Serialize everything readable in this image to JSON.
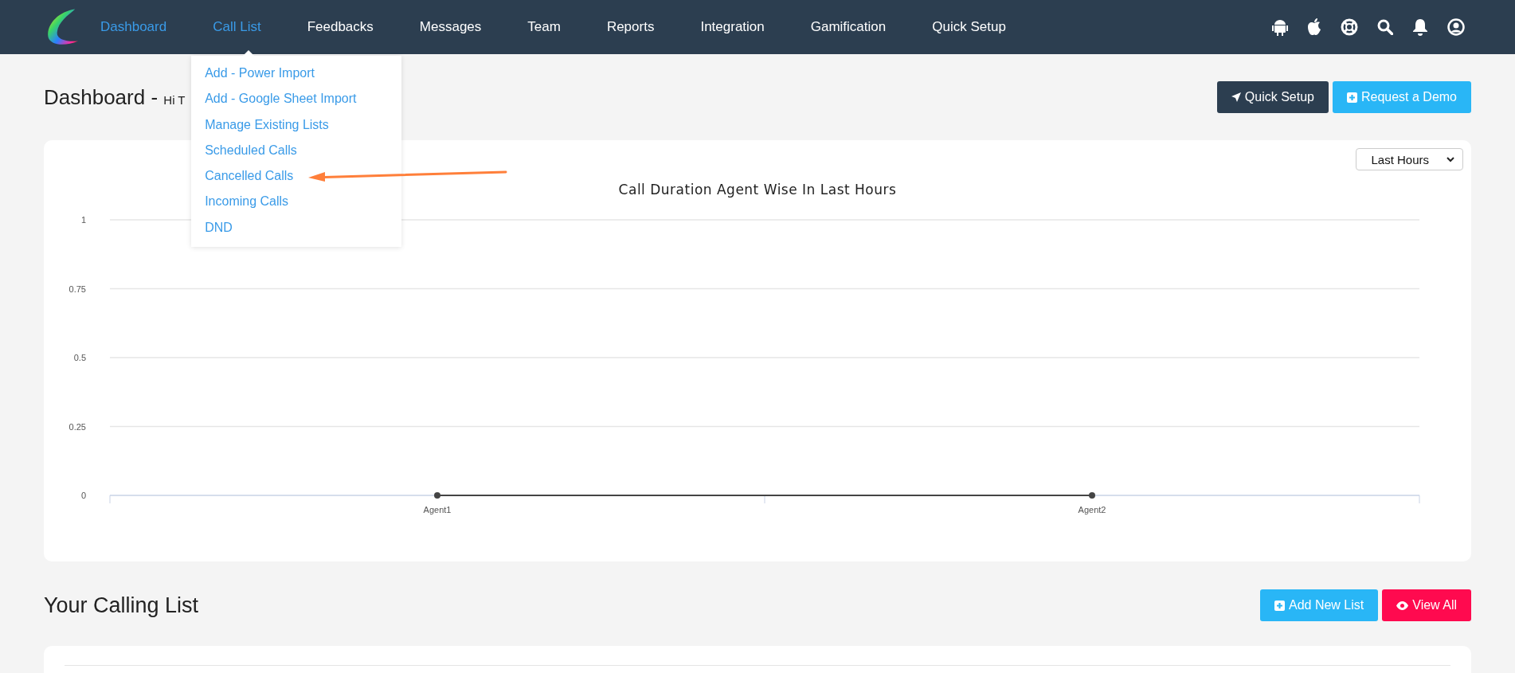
{
  "nav": {
    "items": [
      {
        "label": "Dashboard",
        "highlighted": true,
        "expanded": false
      },
      {
        "label": "Call List",
        "highlighted": true,
        "expanded": true
      },
      {
        "label": "Feedbacks",
        "highlighted": false,
        "expanded": false
      },
      {
        "label": "Messages",
        "highlighted": false,
        "expanded": false
      },
      {
        "label": "Team",
        "highlighted": false,
        "expanded": false
      },
      {
        "label": "Reports",
        "highlighted": false,
        "expanded": false
      },
      {
        "label": "Integration",
        "highlighted": false,
        "expanded": false
      },
      {
        "label": "Gamification",
        "highlighted": false,
        "expanded": false
      },
      {
        "label": "Quick Setup",
        "highlighted": false,
        "expanded": false
      }
    ],
    "dropdown": [
      "Add - Power Import",
      "Add - Google Sheet Import",
      "Manage Existing Lists",
      "Scheduled Calls",
      "Cancelled Calls",
      "Incoming Calls",
      "DND"
    ]
  },
  "header": {
    "title": "Dashboard - ",
    "greeting": "Hi T",
    "buttons": [
      {
        "label": "Quick Setup",
        "kind": "dark"
      },
      {
        "label": "Request a Demo",
        "kind": "info"
      }
    ]
  },
  "chart_card": {
    "period": "Last Hours",
    "chart_data": {
      "type": "line",
      "title": "Call Duration Agent Wise In Last Hours",
      "categories": [
        "Agent1",
        "Agent2"
      ],
      "series": [
        {
          "color": "#444444",
          "marker": true,
          "values": [
            0,
            0
          ]
        }
      ],
      "grid": true,
      "ylim": [
        0,
        1
      ],
      "yticks": [
        0,
        0.25,
        0.5,
        0.75,
        1
      ]
    }
  },
  "calling_list": {
    "title": "Your Calling List",
    "buttons": [
      {
        "label": "Add New List",
        "kind": "info"
      },
      {
        "label": "View All",
        "kind": "danger"
      }
    ]
  }
}
